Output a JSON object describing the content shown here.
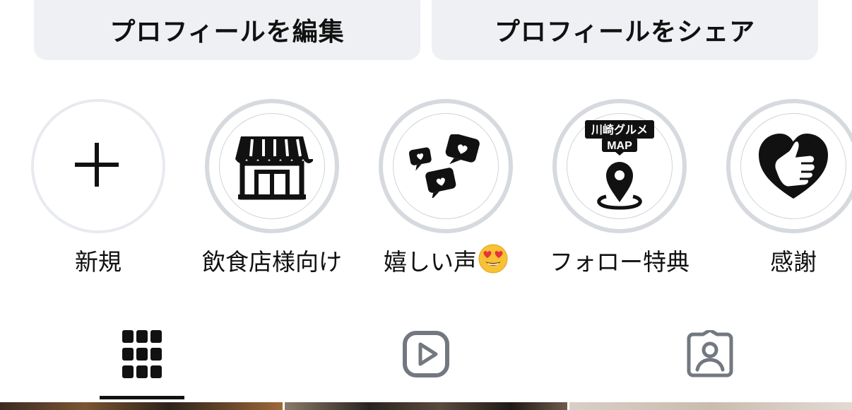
{
  "buttons": {
    "edit_profile": "プロフィールを編集",
    "share_profile": "プロフィールをシェア"
  },
  "highlights": [
    {
      "label": "新規",
      "icon": "plus-icon"
    },
    {
      "label": "飲食店様向け",
      "icon": "storefront-icon"
    },
    {
      "label": "嬉しい声",
      "emoji": "😍",
      "icon": "heart-chat-bubbles-icon"
    },
    {
      "label": "フォロー特典",
      "icon": "map-pin-icon",
      "badge_line1": "川崎グルメ",
      "badge_line2": "MAP"
    },
    {
      "label": "感謝",
      "icon": "thumbs-up-heart-icon"
    }
  ],
  "tabs": [
    {
      "name": "posts-grid",
      "icon": "grid-icon",
      "active": true
    },
    {
      "name": "reels",
      "icon": "reels-play-icon",
      "active": false
    },
    {
      "name": "tagged",
      "icon": "tagged-person-icon",
      "active": false
    }
  ],
  "colors": {
    "button_bg": "#eef0f3",
    "ring": "#d6d9de",
    "text": "#111111",
    "tab_inactive": "#737880"
  }
}
